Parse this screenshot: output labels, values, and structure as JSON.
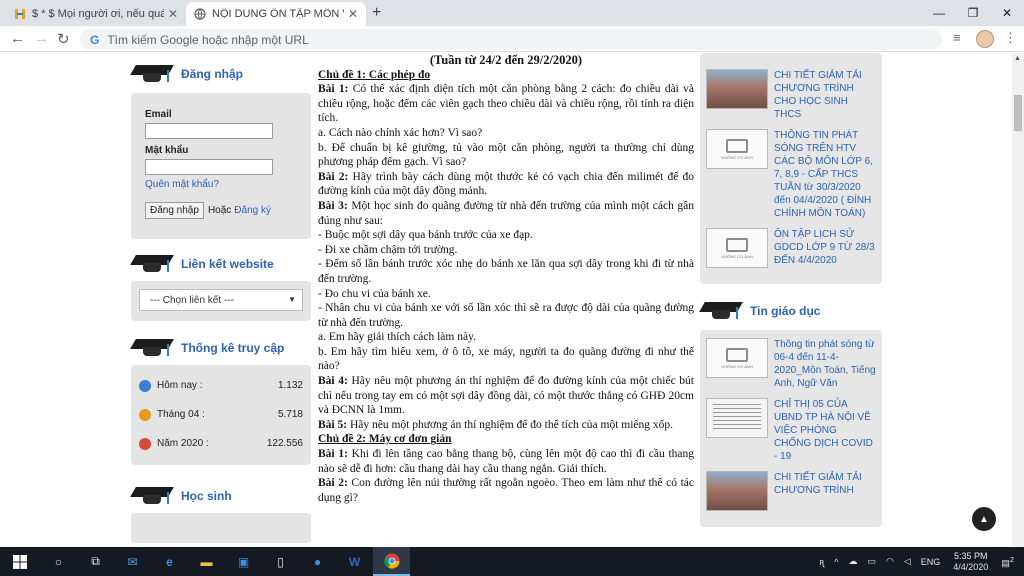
{
  "browser": {
    "tabs": [
      {
        "title": "$ * $ Mọi người ơi, nếu quá nhiều",
        "favicon": "hoc247-icon"
      },
      {
        "title": "NỘI DUNG ÔN TẬP MÔN VẬT LÝ",
        "favicon": "globe-icon"
      }
    ],
    "omnibox_placeholder": "Tìm kiếm Google hoặc nhập một URL"
  },
  "sidebar_left": {
    "login": {
      "title": "Đăng nhập",
      "email_label": "Email",
      "password_label": "Mật khẩu",
      "forgot": "Quên mật khẩu?",
      "login_button": "Đăng nhập",
      "or_text": "Hoặc",
      "register": "Đăng ký"
    },
    "links": {
      "title": "Liên kết website",
      "select_value": "--- Chọn liên kết ---"
    },
    "stats": {
      "title": "Thống kê truy cập",
      "rows": [
        {
          "label": "Hôm nay :",
          "value": "1.132"
        },
        {
          "label": "Tháng 04 :",
          "value": "5.718"
        },
        {
          "label": "Năm 2020 :",
          "value": "122.556"
        }
      ]
    },
    "students": {
      "title": "Học sinh"
    }
  },
  "article": {
    "heading": "(Tuần từ 24/2 đến 29/2/2020)",
    "topic1": "Chủ đề 1: Các phép đo",
    "b1_label": "Bài 1:",
    "b1_text": " Có thể xác định diện tích một căn phòng bằng 2 cách: đo chiều dài và chiều rộng, hoặc đếm các viên gạch theo chiều dài và chiều rộng, rồi tính ra diện tích.",
    "b1_a": "a. Cách nào chính xác hơn? Vì sao?",
    "b1_b": "b. Để chuẩn bị kê giường, tủ vào một căn phòng, người ta thường chỉ dùng phương pháp đếm gạch. Vì sao?",
    "b2_label": "Bài 2:",
    "b2_text": " Hãy trình bày cách dùng một thước kẻ có vạch chia đến milimét để đo đường kính của một dây đồng mảnh.",
    "b3_label": "Bài 3:",
    "b3_text": " Một học sinh đo quãng đường từ nhà đến trường của mình một cách gần đúng như sau:",
    "b3_l1": "- Buộc một sợi dây qua bánh trước của xe đạp.",
    "b3_l2": "- Đi xe chầm chậm tới trường.",
    "b3_l3": "- Đếm số lần bánh trước xóc nhẹ do bánh xe lăn qua sợi dây trong khi đi từ nhà đến trường.",
    "b3_l4": "- Đo chu vi của bánh xe.",
    "b3_l5": "- Nhân chu vi của bánh xe với số lần xóc thì sẽ ra được độ dài của quãng đường từ nhà đến trường.",
    "b3_a": "a. Em hãy giải thích cách làm này.",
    "b3_b": "b. Em hãy tìm hiểu xem, ở ô tô, xe máy, người ta đo quãng đường đi như thế nào?",
    "b4_label": "Bài 4:",
    "b4_text": " Hãy nêu một phương án thí nghiệm để đo đường kính của một chiếc bút chì nếu trong tay em có một sợi dây đồng dài, có một thước thẳng có GHĐ 20cm và ĐCNN là 1mm.",
    "b5_label": "Bài 5:",
    "b5_text": " Hãy nêu một phương án thí nghiệm để đo thể tích của một miếng xốp.",
    "topic2": "Chủ đề 2: Máy cơ đơn giản",
    "c1_label": "Bài 1:",
    "c1_text": " Khi đi lên tầng cao bằng thang bộ, cùng lên một độ cao thì đi cầu thang nào sẽ dễ đi hơn: cầu thang dài hay cầu thang ngắn. Giải thích.",
    "c2_label": "Bài 2:",
    "c2_text": " Con đường lên núi thường rất ngoằn ngoèo. Theo em làm như thế có tác dụng gì?"
  },
  "sidebar_right": {
    "news_top": [
      {
        "text": "CHI TIẾT GIẢM TẢI CHƯƠNG TRÌNH CHO HỌC SINH THCS",
        "thumb": "photo"
      },
      {
        "text": "THÔNG TIN PHÁT SÓNG TRÊN HTV CÁC BỘ MÔN LỚP 6, 7, 8,9 - CẤP THCS TUẦN từ 30/3/2020 đến 04/4/2020 ( ĐÍNH CHÍNH MÔN TOÁN)",
        "thumb": "noimg"
      },
      {
        "text": "ÔN TẬP LỊCH SỬ GDCD LỚP 9 TỪ 28/3 ĐẾN 4/4/2020",
        "thumb": "noimg"
      }
    ],
    "edu_title": "Tin giáo dục",
    "news_edu": [
      {
        "text": "Thông tin phát sóng từ 06-4 đến 11-4-2020_Môn Toán, Tiếng Anh, Ngữ Văn",
        "thumb": "noimg"
      },
      {
        "text": "CHỈ THỊ 05 CỦA UBND TP HÀ NỘI VỀ VIỆC PHÒNG CHỐNG DỊCH COVID - 19",
        "thumb": "doc"
      },
      {
        "text": "CHI TIẾT GIẢM TẢI CHƯƠNG TRÌNH",
        "thumb": "photo"
      }
    ],
    "noimg_caption": "KHÔNG CÓ ẢNH"
  },
  "taskbar": {
    "lang": "ENG",
    "time": "5:35 PM",
    "date": "4/4/2020",
    "notif_count": "2"
  }
}
